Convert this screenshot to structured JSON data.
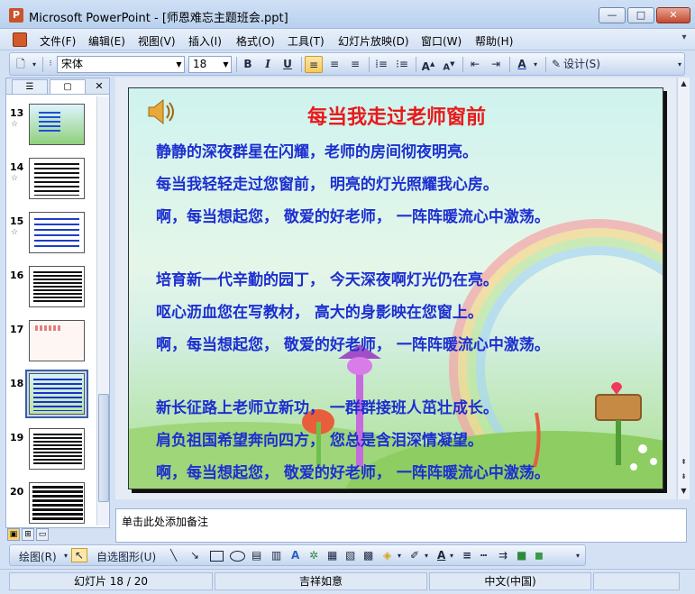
{
  "window": {
    "title": "Microsoft PowerPoint - [师恩难忘主题班会.ppt]",
    "min_label": "—",
    "max_label": "□",
    "close_label": "✕"
  },
  "menu": {
    "items": [
      "文件(F)",
      "编辑(E)",
      "视图(V)",
      "插入(I)",
      "格式(O)",
      "工具(T)",
      "幻灯片放映(D)",
      "窗口(W)",
      "帮助(H)"
    ]
  },
  "toolbar": {
    "font": "宋体",
    "size": "18",
    "bold": "B",
    "italic": "I",
    "underline": "U",
    "design": "设计(S)"
  },
  "slide_panel": {
    "thumbnails": [
      {
        "num": "13",
        "star": "☆"
      },
      {
        "num": "14",
        "star": "☆"
      },
      {
        "num": "15",
        "star": "☆"
      },
      {
        "num": "16",
        "star": ""
      },
      {
        "num": "17",
        "star": ""
      },
      {
        "num": "18",
        "star": ""
      },
      {
        "num": "19",
        "star": ""
      },
      {
        "num": "20",
        "star": ""
      }
    ],
    "selected": "18"
  },
  "slide": {
    "title": "每当我走过老师窗前",
    "lines": [
      "静静的深夜群星在闪耀，老师的房间彻夜明亮。",
      "每当我轻轻走过您窗前， 明亮的灯光照耀我心房。",
      "啊，每当想起您， 敬爱的好老师， 一阵阵暖流心中激荡。",
      "培育新一代辛勤的园丁， 今天深夜啊灯光仍在亮。",
      "呕心沥血您在写教材， 高大的身影映在您窗上。",
      " 啊，每当想起您， 敬爱的好老师， 一阵阵暖流心中激荡。",
      "新长征路上老师立新功， 一群群接班人茁壮成长。",
      "肩负祖国希望奔向四方， 您总是含泪深情凝望。",
      " 啊，每当想起您， 敬爱的好老师， 一阵阵暖流心中激荡。"
    ]
  },
  "notes": {
    "placeholder": "单击此处添加备注"
  },
  "drawbar": {
    "draw": "绘图(R)",
    "autoshapes": "自选图形(U)"
  },
  "status": {
    "slide_info": "幻灯片 18 / 20",
    "design": "吉祥如意",
    "language": "中文(中国)"
  }
}
